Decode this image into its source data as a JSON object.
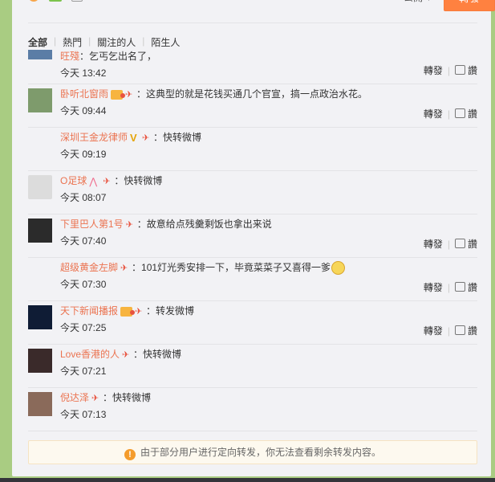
{
  "composer": {
    "visibility": "公開",
    "forward_label": "轉發"
  },
  "tabs": [
    {
      "label": "全部"
    },
    {
      "label": "熱門"
    },
    {
      "label": "關注的人"
    },
    {
      "label": "陌生人"
    }
  ],
  "reposts": [
    {
      "user": "旺殘",
      "content": "乞丐乞出名了，",
      "time": "今天 13:42",
      "forward": "轉發",
      "like": "讚"
    },
    {
      "user": "卧听北窗雨",
      "content": "这典型的就是花钱买通几个官宣，搞一点政治水花。",
      "time": "今天 09:44",
      "forward": "轉發",
      "like": "讚"
    },
    {
      "user": "深圳王金龙律师",
      "content": "快转微博",
      "time": "今天 09:19",
      "forward": "",
      "like": ""
    },
    {
      "user": "O足球",
      "content": "快转微博",
      "time": "今天 08:07",
      "forward": "",
      "like": ""
    },
    {
      "user": "下里巴人第1号",
      "content": "故意给点残羹剩饭也拿出来说",
      "time": "今天 07:40",
      "forward": "轉發",
      "like": "讚"
    },
    {
      "user": "超级黄金左脚",
      "content": "101灯光秀安排一下，毕竟菜菜子又喜得一爹",
      "time": "今天 07:30",
      "forward": "轉發",
      "like": "讚"
    },
    {
      "user": "天下新闻播报",
      "content": "转发微博",
      "time": "今天 07:25",
      "forward": "轉發",
      "like": "讚"
    },
    {
      "user": "Love香港的人",
      "content": "快转微博",
      "time": "今天 07:21",
      "forward": "",
      "like": ""
    },
    {
      "user": "倪达泽",
      "content": "快转微博",
      "time": "今天 07:13",
      "forward": "",
      "like": ""
    }
  ],
  "notice": "由于部分用户进行定向转发，你无法查看剩余转发内容。"
}
